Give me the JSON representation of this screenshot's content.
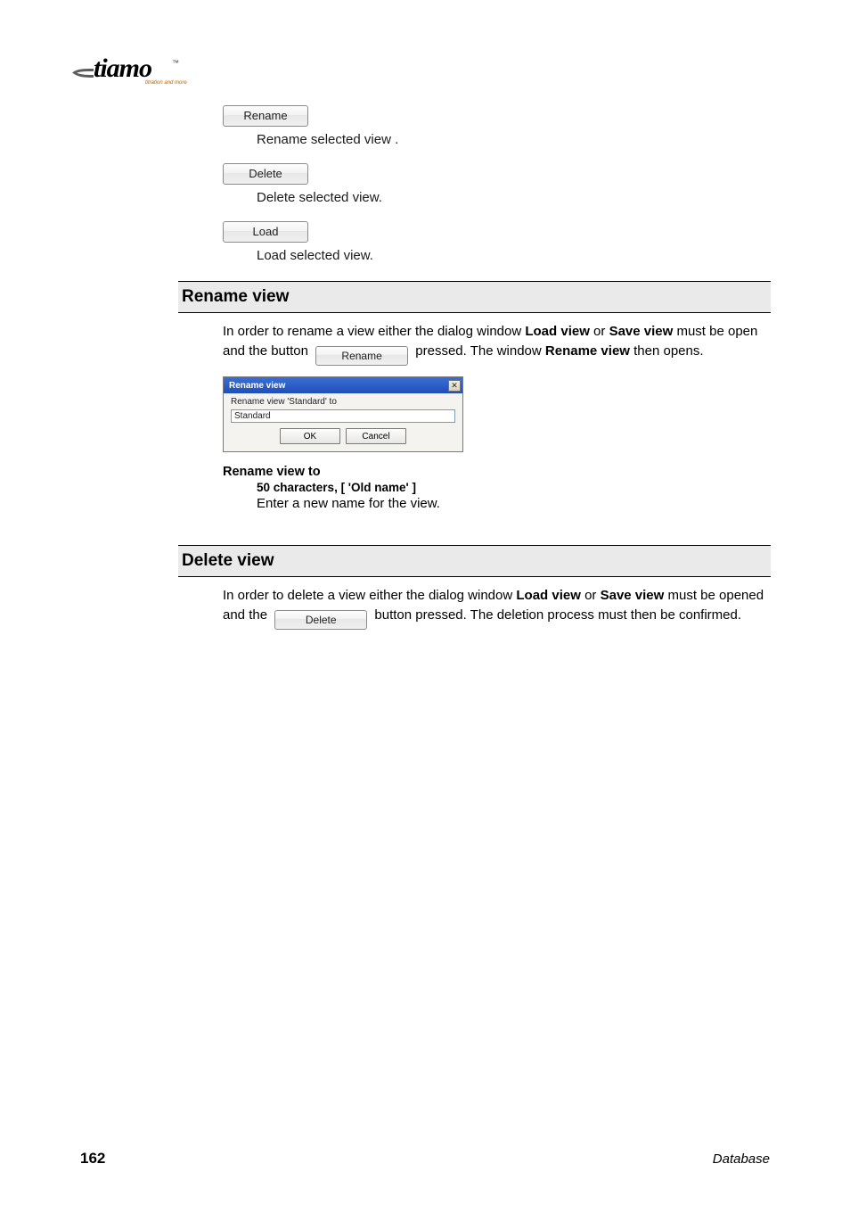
{
  "logo": {
    "brand": "tiamo",
    "tm": "™",
    "tagline": "titration and more"
  },
  "buttons_list": {
    "rename": {
      "label": "Rename",
      "desc": "Rename selected view ."
    },
    "delete": {
      "label": "Delete",
      "desc": "Delete selected view."
    },
    "load": {
      "label": "Load",
      "desc": "Load selected view."
    }
  },
  "section_rename": {
    "heading": "Rename view",
    "p1_a": "In order to rename a view either the dialog window ",
    "p1_b": "Load view",
    "p1_c": " or ",
    "p1_d": "Save view",
    "p1_e": " must be open and the button ",
    "p1_btn": "Rename",
    "p1_f": " pressed. The window ",
    "p1_g": "Rename view",
    "p1_h": " then opens.",
    "dialog": {
      "title": "Rename view",
      "label": "Rename view 'Standard' to",
      "input_value": "Standard",
      "ok": "OK",
      "cancel": "Cancel"
    },
    "param": {
      "heading": "Rename view to",
      "sub": "50 characters, [ 'Old name' ]",
      "desc": "Enter a new name for the view."
    }
  },
  "section_delete": {
    "heading": "Delete view",
    "p1_a": "In order to delete a view either the dialog window ",
    "p1_b": "Load view",
    "p1_c": " or ",
    "p1_d": "Save view",
    "p1_e": " must be opened and the ",
    "p1_btn": "Delete",
    "p1_f": " button pressed. The deletion process must then be confirmed."
  },
  "footer": {
    "page": "162",
    "right": "Database"
  }
}
